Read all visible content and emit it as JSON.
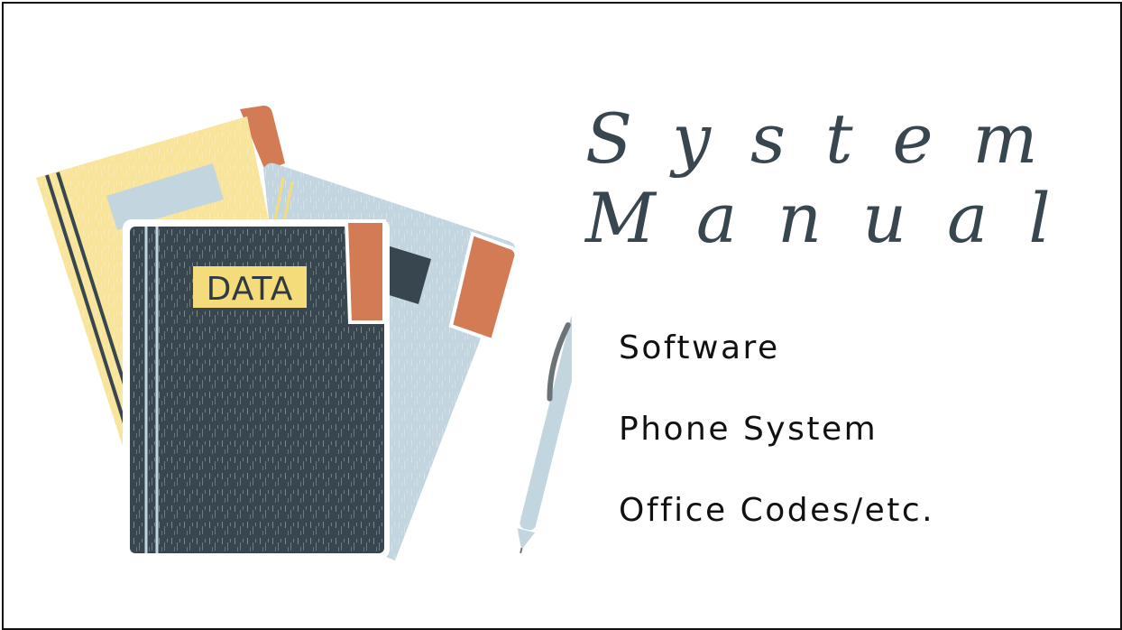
{
  "title": {
    "line1": "System",
    "line2": "Manual"
  },
  "topics": [
    "Software",
    "Phone System",
    "Office Codes/etc."
  ],
  "illustration": {
    "book_label": "DATA",
    "icons": [
      "yellow-folder-icon",
      "blue-folder-icon",
      "dark-binder-icon",
      "pen-icon"
    ]
  },
  "colors": {
    "title": "#37464f",
    "binder": "#37464f",
    "folder_yellow": "#f8e49a",
    "folder_blue": "#c3d6e0",
    "tab_orange": "#d27b55",
    "label_yellow": "#f5dc7a",
    "border": "#111111"
  }
}
